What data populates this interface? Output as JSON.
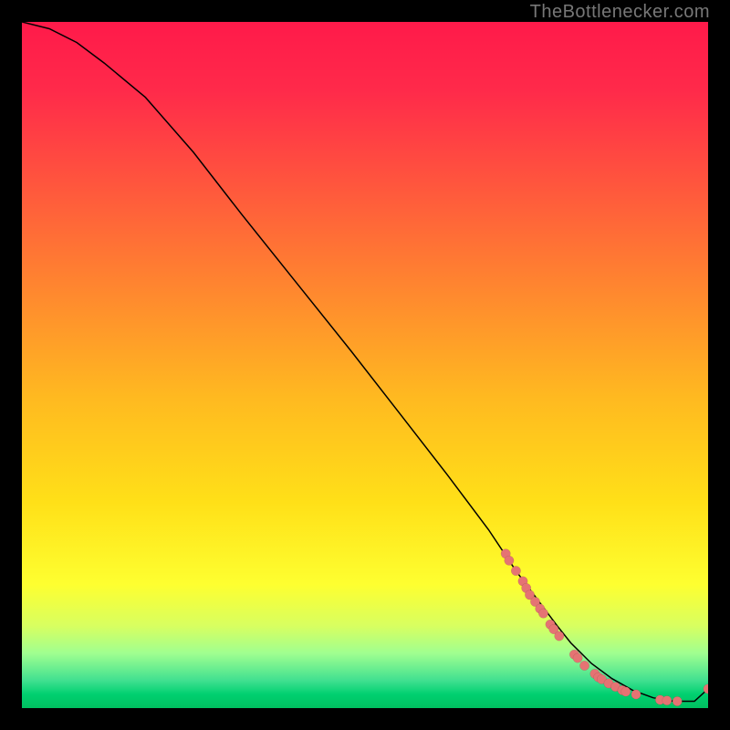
{
  "attribution": "TheBottlenecker.com",
  "chart_data": {
    "type": "line",
    "title": "",
    "xlabel": "",
    "ylabel": "",
    "xlim": [
      0,
      100
    ],
    "ylim": [
      0,
      100
    ],
    "curve": {
      "x": [
        0,
        4,
        8,
        12,
        18,
        25,
        32,
        40,
        48,
        55,
        62,
        68,
        72,
        75,
        78,
        80,
        83,
        86,
        89,
        92,
        95,
        98,
        100
      ],
      "y": [
        100,
        99,
        97,
        94,
        89,
        81,
        72,
        62,
        52,
        43,
        34,
        26,
        20,
        16,
        12,
        9.5,
        6.5,
        4.3,
        2.6,
        1.5,
        1.0,
        1.0,
        2.8
      ]
    },
    "points": {
      "x": [
        70.5,
        71.0,
        72.0,
        73.0,
        73.5,
        74.0,
        74.8,
        75.5,
        76.0,
        77.0,
        77.5,
        78.3,
        80.5,
        81.0,
        82.0,
        83.5,
        84.0,
        84.5,
        85.5,
        86.5,
        87.5,
        88.0,
        89.5,
        93.0,
        94.0,
        95.5,
        100.0
      ],
      "y": [
        22.5,
        21.5,
        20.0,
        18.5,
        17.5,
        16.5,
        15.5,
        14.5,
        13.8,
        12.2,
        11.5,
        10.5,
        7.8,
        7.3,
        6.2,
        5.0,
        4.5,
        4.2,
        3.6,
        3.1,
        2.6,
        2.4,
        2.0,
        1.2,
        1.1,
        1.0,
        2.8
      ]
    },
    "marker_color": "#e57373"
  }
}
